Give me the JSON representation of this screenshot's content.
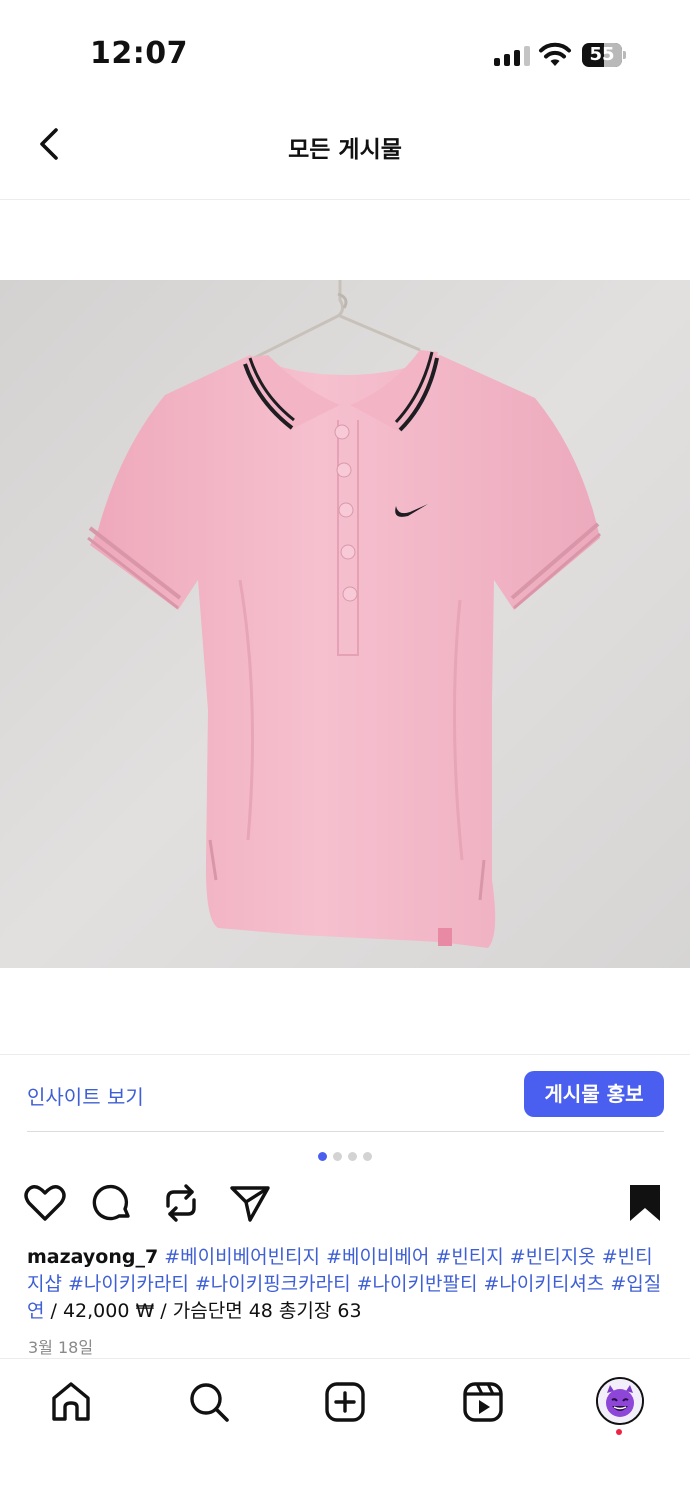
{
  "status_bar": {
    "time": "12:07",
    "battery_label": "55",
    "battery_level": 0.55,
    "signal_bars_active": 3,
    "signal_bars_total": 4
  },
  "header": {
    "title": "모든 게시물",
    "back_icon": "chevron-left-icon"
  },
  "post": {
    "image": "pink-nike-polo-shirt-on-hanger",
    "image_count": 4,
    "active_image_index": 0,
    "insight_link": "인사이트 보기",
    "promote_button": "게시물 홍보",
    "actions": [
      "heart-icon",
      "comment-icon",
      "repost-icon",
      "share-icon",
      "bookmark-icon"
    ],
    "caption": {
      "username": "mazayong_7",
      "hashtags": "#베이비베어빈티지 #베이비베어 #빈티지 #빈티지옷 #빈티지샵 #나이키카라티 #나이키핑크카라티 #나이키반팔티  #나이키티셔츠 #입질연",
      "details": " / 42,000 ₩ / 가슴단면 48 총기장 63"
    },
    "date": "3월 18일"
  },
  "tab_bar": {
    "items": [
      "home-icon",
      "search-icon",
      "create-icon",
      "reels-icon",
      "profile-avatar"
    ]
  },
  "colors": {
    "accent": "#4a5ff0",
    "link": "#3f5fd4",
    "notification": "#ef2244",
    "shirt": "#f2b8c8",
    "wall": "#dcdad8"
  }
}
